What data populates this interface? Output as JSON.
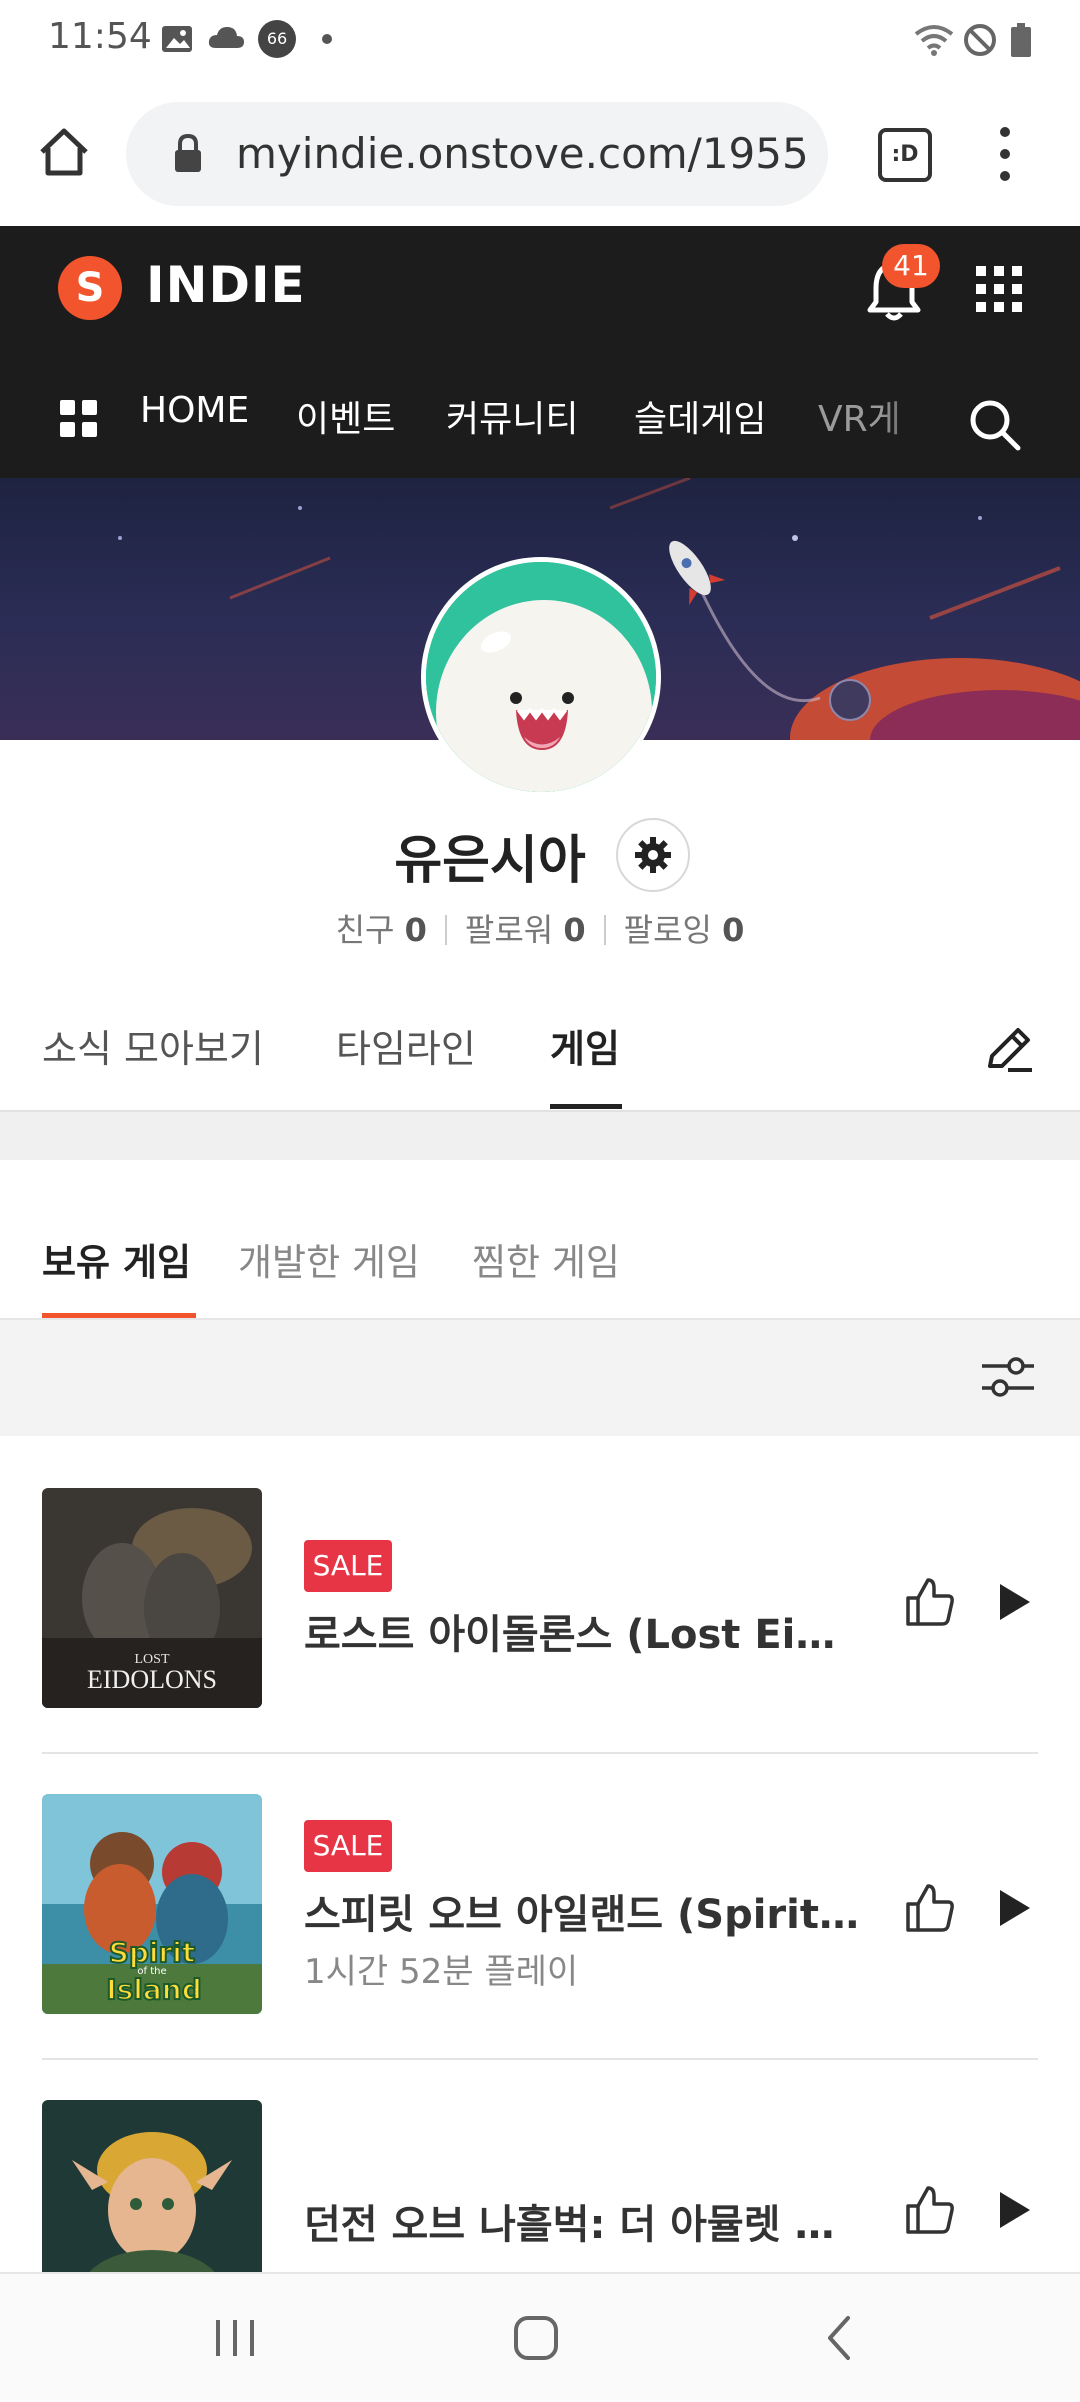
{
  "status_bar": {
    "time": "11:54",
    "notif_count": "66"
  },
  "browser": {
    "url": "myindie.onstove.com/1955"
  },
  "header": {
    "logo_letter": "S",
    "logo_text": "INDIE",
    "notification_badge": "41",
    "nav_items": [
      "HOME",
      "이벤트",
      "커뮤니티",
      "슬데게임",
      "VR게"
    ]
  },
  "profile": {
    "name": "유은시아",
    "stats": [
      {
        "label": "친구",
        "value": "0"
      },
      {
        "label": "팔로워",
        "value": "0"
      },
      {
        "label": "팔로잉",
        "value": "0"
      }
    ]
  },
  "tabs": [
    "소식 모아보기",
    "타임라인",
    "게임"
  ],
  "active_tab": "게임",
  "sub_tabs": [
    "보유 게임",
    "개발한 게임",
    "찜한 게임"
  ],
  "active_sub_tab": "보유 게임",
  "games": [
    {
      "thumb_text": "LOST EIDOLONS",
      "sale_label": "SALE",
      "title": "로스트 아이돌론스 (Lost Eidolons)",
      "play_time": ""
    },
    {
      "thumb_text": "Spirit of the Island",
      "sale_label": "SALE",
      "title": "스피릿 오브 아일랜드 (Spirit of the Island)",
      "play_time": "1시간 52분 플레이"
    },
    {
      "thumb_text": "",
      "sale_label": "",
      "title": "던전 오브 나흘벅: 더 아뮬렛 오브 카오스",
      "play_time": ""
    }
  ],
  "colors": {
    "accent": "#f2542d",
    "header_bg": "#1c1c1c",
    "sale_bg": "#e83546",
    "avatar_bg": "#2fc29d"
  }
}
